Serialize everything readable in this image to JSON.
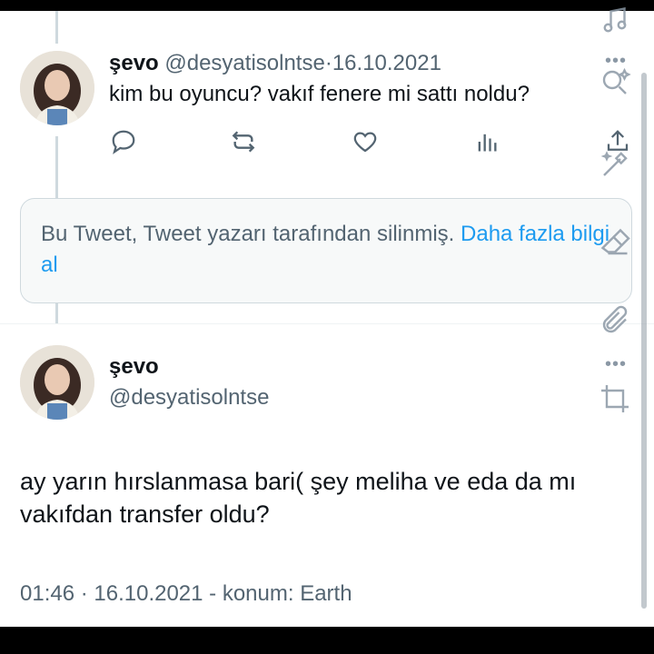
{
  "tweet1": {
    "name": "şevo",
    "handle": "@desyatisolntse",
    "separator": "·",
    "date": "16.10.2021",
    "text": "kim bu oyuncu? vakıf fenere mi sattı noldu?"
  },
  "deleted_notice": {
    "text": "Bu Tweet, Tweet yazarı tarafından silinmiş.",
    "link": "Daha fazla bilgi al"
  },
  "tweet2": {
    "name": "şevo",
    "handle": "@desyatisolntse",
    "text": "ay yarın hırslanmasa bari(  şey meliha ve eda da mı vakıfdan transfer oldu?",
    "meta": "01:46 · 16.10.2021 - konum: Earth"
  },
  "icons": {
    "reply": "reply-icon",
    "retweet": "retweet-icon",
    "like": "like-icon",
    "views": "views-icon",
    "share": "share-icon",
    "music": "music-icon",
    "search": "magic-search-icon",
    "magic": "magic-wand-icon",
    "eraser": "eraser-icon",
    "clip": "paperclip-icon",
    "crop": "crop-icon",
    "more": "more-icon"
  },
  "colors": {
    "link": "#1d9bf0",
    "muted": "#536471",
    "text": "#0f1419",
    "border": "#cfd9de"
  }
}
